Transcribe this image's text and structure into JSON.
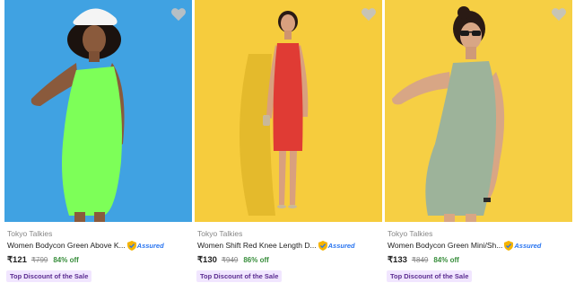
{
  "products": [
    {
      "brand": "Tokyo Talkies",
      "title": "Women Bodycon Green Above K...",
      "assured_label": "Assured",
      "price": "₹121",
      "mrp": "₹799",
      "discount": "84% off",
      "tag": "Top Discount of the Sale",
      "bg_color": "#3b9ee0",
      "dress_color": "#7dff58",
      "wishlisted": false
    },
    {
      "brand": "Tokyo Talkies",
      "title": "Women Shift Red Knee Length D...",
      "assured_label": "Assured",
      "price": "₹130",
      "mrp": "₹949",
      "discount": "86% off",
      "tag": "Top Discount of the Sale",
      "bg_color": "#f6cc3d",
      "dress_color": "#e03b34",
      "wishlisted": false
    },
    {
      "brand": "Tokyo Talkies",
      "title": "Women Bodycon Green Mini/Sh...",
      "assured_label": "Assured",
      "price": "₹133",
      "mrp": "₹849",
      "discount": "84% off",
      "tag": "Top Discount of the Sale",
      "bg_color": "#f6cf44",
      "dress_color": "#9db39a",
      "wishlisted": false
    }
  ],
  "icons": {
    "wishlist": "heart-icon",
    "assured": "assured-badge-icon"
  },
  "colors": {
    "assured_blue": "#2874f0",
    "discount_green": "#388e3c",
    "tag_purple": "#5c2d91"
  }
}
